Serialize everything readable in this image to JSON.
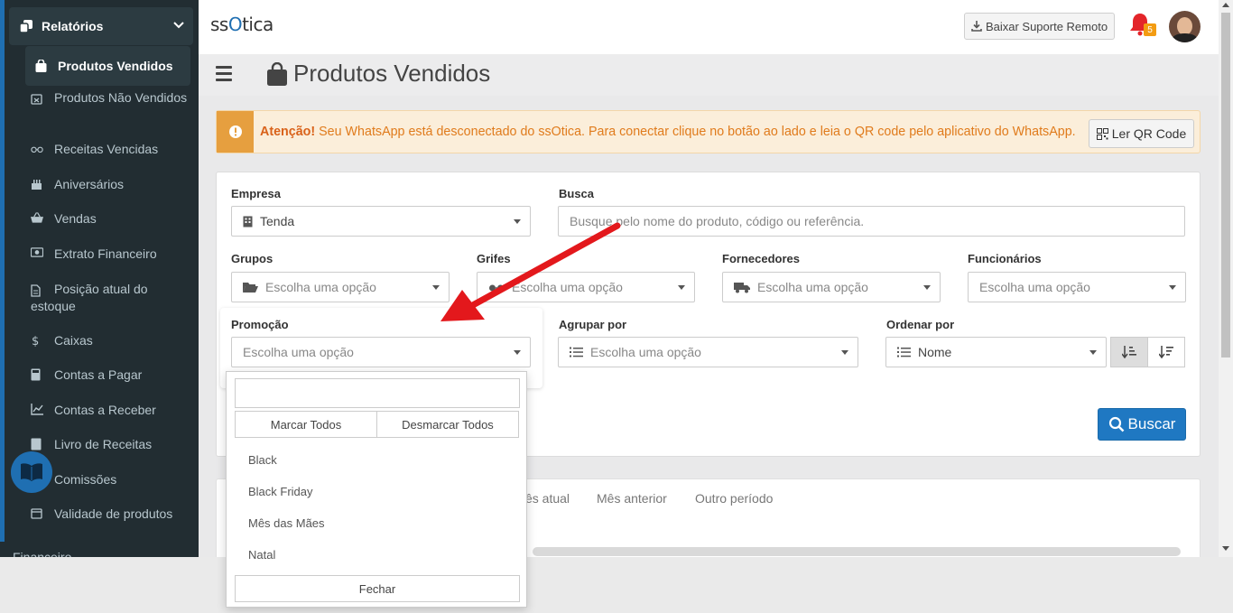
{
  "sidebar": {
    "section_title": "Relatórios",
    "active_item": "Produtos Vendidos",
    "items": [
      {
        "label": "Produtos Não Vendidos",
        "icon": "calendar-x-icon"
      },
      {
        "label": "Receitas Vencidas",
        "icon": "glasses-icon"
      },
      {
        "label": "Aniversários",
        "icon": "cake-icon"
      },
      {
        "label": "Vendas",
        "icon": "basket-icon"
      },
      {
        "label": "Extrato Financeiro",
        "icon": "money-icon"
      },
      {
        "label": "Posição atual do estoque",
        "icon": "file-icon"
      },
      {
        "label": "Caixas",
        "icon": "dollar-icon"
      },
      {
        "label": "Contas a Pagar",
        "icon": "calculator-icon"
      },
      {
        "label": "Contas a Receber",
        "icon": "chart-line-icon"
      },
      {
        "label": "Livro de Receitas",
        "icon": "book-icon"
      },
      {
        "label": "Comissões",
        "icon": "percent-icon"
      },
      {
        "label": "Validade de produtos",
        "icon": "calendar-icon"
      }
    ],
    "next_section": "Financeiro"
  },
  "header": {
    "logo_pre": "ss",
    "logo_o": "O",
    "logo_post": "tica",
    "support_button": "Baixar Suporte Remoto",
    "notification_count": "5"
  },
  "page": {
    "title": "Produtos Vendidos"
  },
  "alert": {
    "strong": "Atenção!",
    "message": " Seu WhatsApp está desconectado do ssOtica. Para conectar clique no botão ao lado e leia o QR code pelo aplicativo do WhatsApp.",
    "button": "Ler QR Code"
  },
  "filters": {
    "empresa": {
      "label": "Empresa",
      "value": "Tenda"
    },
    "busca": {
      "label": "Busca",
      "placeholder": "Busque pelo nome do produto, código ou referência."
    },
    "grupos": {
      "label": "Grupos",
      "placeholder": "Escolha uma opção"
    },
    "grifes": {
      "label": "Grifes",
      "placeholder": "Escolha uma opção"
    },
    "fornecedores": {
      "label": "Fornecedores",
      "placeholder": "Escolha uma opção"
    },
    "funcionarios": {
      "label": "Funcionários",
      "placeholder": "Escolha uma opção"
    },
    "promocao": {
      "label": "Promoção",
      "placeholder": "Escolha uma opção"
    },
    "agrupar": {
      "label": "Agrupar por",
      "placeholder": "Escolha uma opção"
    },
    "ordenar": {
      "label": "Ordenar por",
      "value": "Nome"
    },
    "search_button": "Buscar"
  },
  "dropdown": {
    "select_all": "Marcar Todos",
    "deselect_all": "Desmarcar Todos",
    "options": [
      "Black",
      "Black Friday",
      "Mês das Mães",
      "Natal"
    ],
    "close": "Fechar"
  },
  "tabs": {
    "partial": "ês atual",
    "previous": "Mês anterior",
    "other": "Outro período"
  },
  "colors": {
    "primary": "#1f78c2",
    "sidebar": "#222d32",
    "arrow": "#e3181c",
    "alert_text": "#e07b1c"
  }
}
